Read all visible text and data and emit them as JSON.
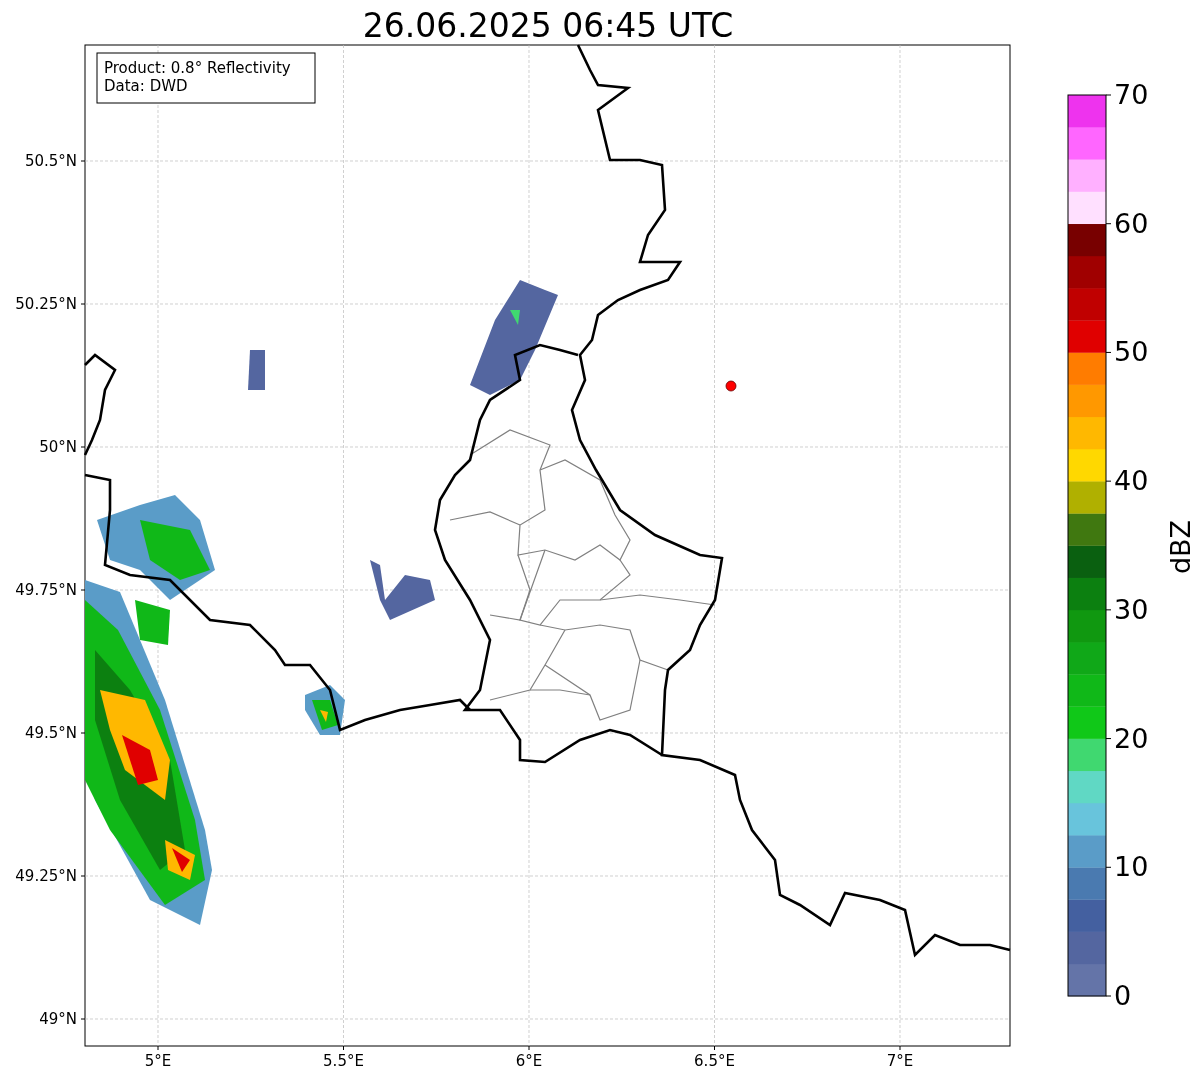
{
  "title": "26.06.2025 06:45 UTC",
  "legend": [
    "Product: 0.8° Reflectivity",
    "Data: DWD"
  ],
  "map": {
    "x_ticks": [
      "5°E",
      "5.5°E",
      "6°E",
      "6.5°E",
      "7°E"
    ],
    "y_ticks": [
      "50.5°N",
      "50.25°N",
      "50°N",
      "49.75°N",
      "49.5°N",
      "49.25°N",
      "49°N"
    ]
  },
  "colorbar": {
    "label": "dBZ",
    "ticks": [
      "70",
      "60",
      "50",
      "40",
      "30",
      "20",
      "10",
      "0"
    ],
    "segments": [
      {
        "color": "#6474a8"
      },
      {
        "color": "#5466a0"
      },
      {
        "color": "#4460a0"
      },
      {
        "color": "#4a7ab0"
      },
      {
        "color": "#5a9cc8"
      },
      {
        "color": "#68c4dc"
      },
      {
        "color": "#60d8c4"
      },
      {
        "color": "#40d870"
      },
      {
        "color": "#10c818"
      },
      {
        "color": "#10b818"
      },
      {
        "color": "#10a818"
      },
      {
        "color": "#109810"
      },
      {
        "color": "#0c8010"
      },
      {
        "color": "#0a6010"
      },
      {
        "color": "#407810"
      },
      {
        "color": "#b0b000"
      },
      {
        "color": "#ffd800"
      },
      {
        "color": "#ffb800"
      },
      {
        "color": "#ff9800"
      },
      {
        "color": "#ff7c00"
      },
      {
        "color": "#e00000"
      },
      {
        "color": "#c00000"
      },
      {
        "color": "#a00000"
      },
      {
        "color": "#780000"
      },
      {
        "color": "#ffe0ff"
      },
      {
        "color": "#ffb0ff"
      },
      {
        "color": "#ff66ff"
      },
      {
        "color": "#ee33ee"
      }
    ]
  }
}
